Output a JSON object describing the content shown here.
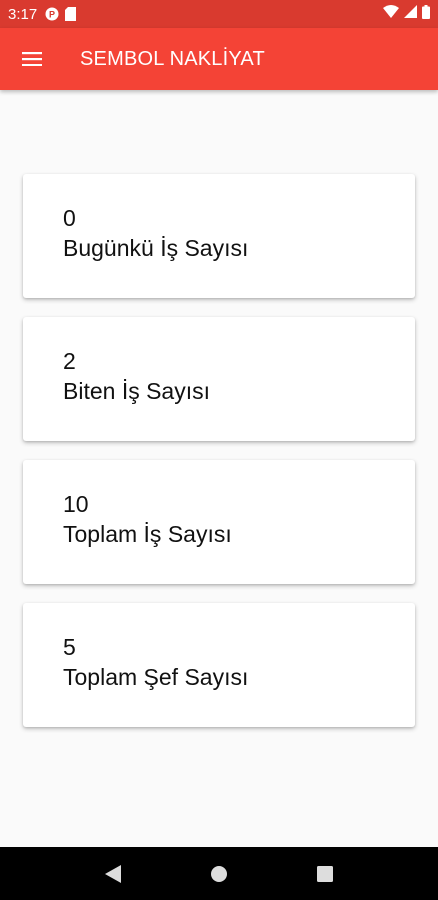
{
  "status_bar": {
    "time": "3:17",
    "left_icons": [
      "notification-p-icon",
      "sd-card-icon"
    ],
    "right_icons": [
      "wifi-icon",
      "signal-icon",
      "battery-icon"
    ]
  },
  "app_bar": {
    "title": "SEMBOL NAKLİYAT",
    "color": "#f44336"
  },
  "cards": [
    {
      "value": "0",
      "label": "Bugünkü İş Sayısı"
    },
    {
      "value": "2",
      "label": "Biten İş Sayısı"
    },
    {
      "value": "10",
      "label": "Toplam İş Sayısı"
    },
    {
      "value": "5",
      "label": "Toplam Şef Sayısı"
    }
  ],
  "nav_bar": {
    "buttons": [
      "back-icon",
      "home-icon",
      "recents-icon"
    ]
  }
}
